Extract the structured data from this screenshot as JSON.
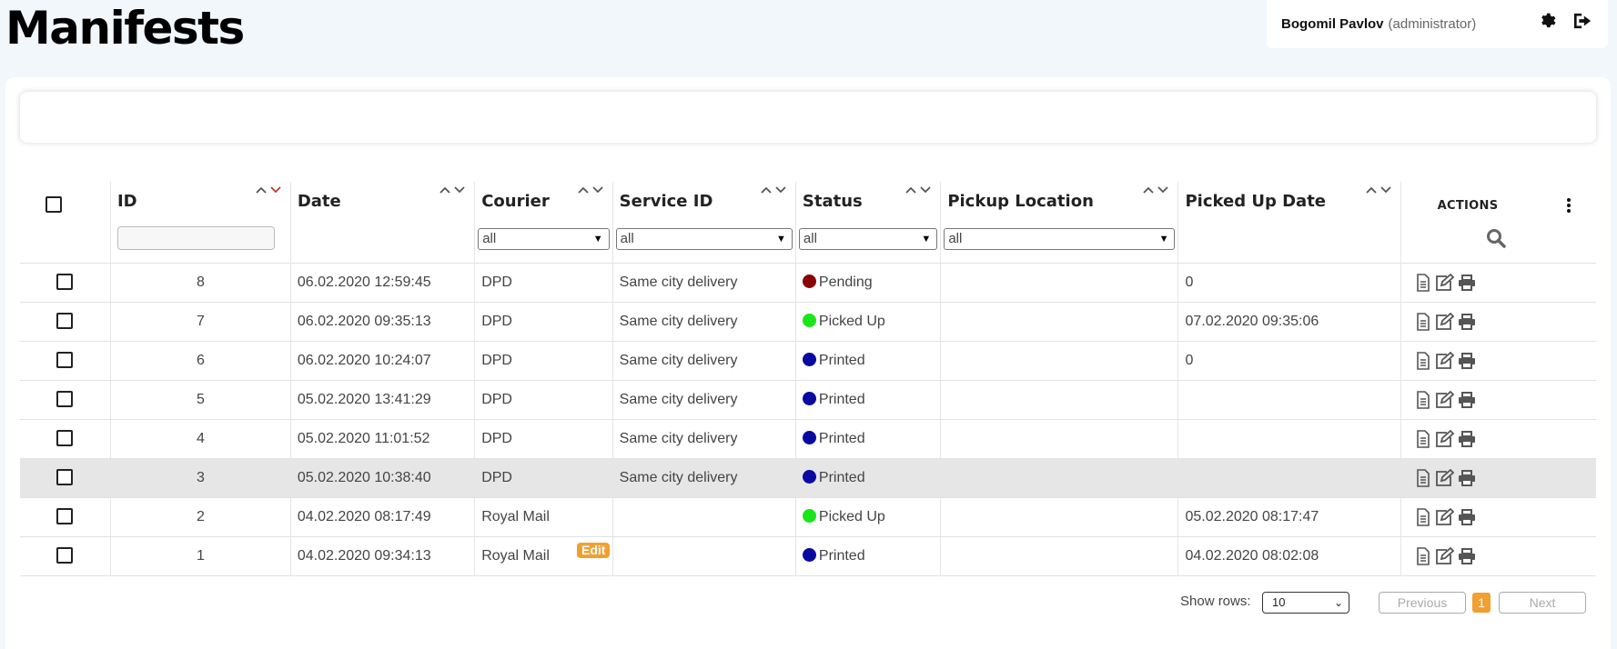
{
  "page": {
    "title": "Manifests"
  },
  "user": {
    "name": "Bogomil Pavlov",
    "role": "(administrator)"
  },
  "table": {
    "columns": {
      "id": "ID",
      "date": "Date",
      "courier": "Courier",
      "service_id": "Service ID",
      "status": "Status",
      "pickup_location": "Pickup Location",
      "picked_up_date": "Picked Up Date",
      "actions": "ACTIONS"
    },
    "filters": {
      "courier": "all",
      "service_id": "all",
      "status": "all",
      "pickup_location": "all"
    },
    "rows": [
      {
        "id": "8",
        "date": "06.02.2020 12:59:45",
        "courier": "DPD",
        "service": "Same city delivery",
        "status": "Pending",
        "status_color": "#8b0000",
        "pickup": "",
        "picked": "0"
      },
      {
        "id": "7",
        "date": "06.02.2020 09:35:13",
        "courier": "DPD",
        "service": "Same city delivery",
        "status": "Picked Up",
        "status_color": "#19e619",
        "pickup": "",
        "picked": "07.02.2020 09:35:06"
      },
      {
        "id": "6",
        "date": "06.02.2020 10:24:07",
        "courier": "DPD",
        "service": "Same city delivery",
        "status": "Printed",
        "status_color": "#0a0aa0",
        "pickup": "",
        "picked": "0"
      },
      {
        "id": "5",
        "date": "05.02.2020 13:41:29",
        "courier": "DPD",
        "service": "Same city delivery",
        "status": "Printed",
        "status_color": "#0a0aa0",
        "pickup": "",
        "picked": ""
      },
      {
        "id": "4",
        "date": "05.02.2020 11:01:52",
        "courier": "DPD",
        "service": "Same city delivery",
        "status": "Printed",
        "status_color": "#0a0aa0",
        "pickup": "",
        "picked": ""
      },
      {
        "id": "3",
        "date": "05.02.2020 10:38:40",
        "courier": "DPD",
        "service": "Same city delivery",
        "status": "Printed",
        "status_color": "#0a0aa0",
        "pickup": "",
        "picked": ""
      },
      {
        "id": "2",
        "date": "04.02.2020 08:17:49",
        "courier": "Royal Mail",
        "service": "",
        "status": "Picked Up",
        "status_color": "#19e619",
        "pickup": "",
        "picked": "05.02.2020 08:17:47"
      },
      {
        "id": "1",
        "date": "04.02.2020 09:34:13",
        "courier": "Royal Mail",
        "service": "",
        "status": "Printed",
        "status_color": "#0a0aa0",
        "pickup": "",
        "picked": "04.02.2020 08:02:08"
      }
    ],
    "edit_badge": "Edit"
  },
  "pagination": {
    "show_rows_label": "Show rows:",
    "rows_per_page": "10",
    "previous": "Previous",
    "current_page": "1",
    "next": "Next"
  },
  "colors": {
    "accent": "#f0a030",
    "sort_active": "#c0392b",
    "highlight_row": "#e6e6e6"
  }
}
